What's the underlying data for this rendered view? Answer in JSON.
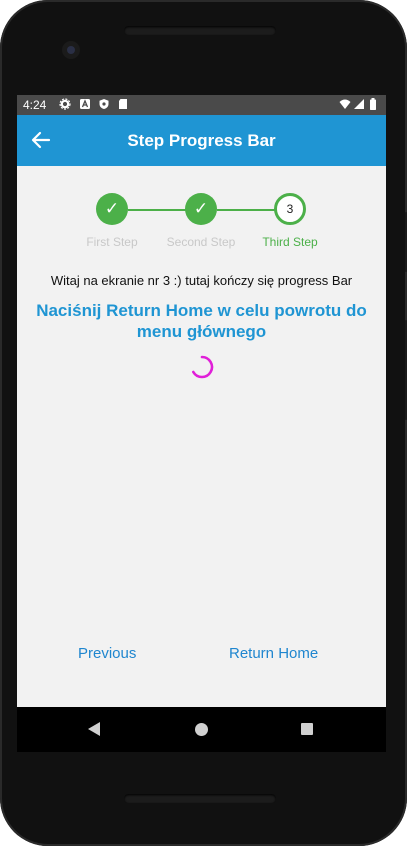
{
  "status": {
    "time": "4:24"
  },
  "app_bar": {
    "title": "Step Progress Bar",
    "back_icon": "arrow-back-icon"
  },
  "stepper": {
    "steps": [
      {
        "label": "First Step",
        "state": "done",
        "mark": "✓"
      },
      {
        "label": "Second Step",
        "state": "done",
        "mark": "✓"
      },
      {
        "label": "Third Step",
        "state": "current",
        "mark": "3"
      }
    ],
    "active_color": "#4cb049",
    "inactive_label_color": "#c8c8c8"
  },
  "content": {
    "welcome": "Witaj na ekranie nr 3 :) tutaj kończy się progress Bar",
    "instruction": "Naciśnij Return Home w celu powrotu do menu głównego",
    "spinner_color": "#e020d8"
  },
  "footer": {
    "previous": "Previous",
    "return_home": "Return Home"
  },
  "colors": {
    "primary": "#1f95d3",
    "background": "#f2f2f2"
  }
}
